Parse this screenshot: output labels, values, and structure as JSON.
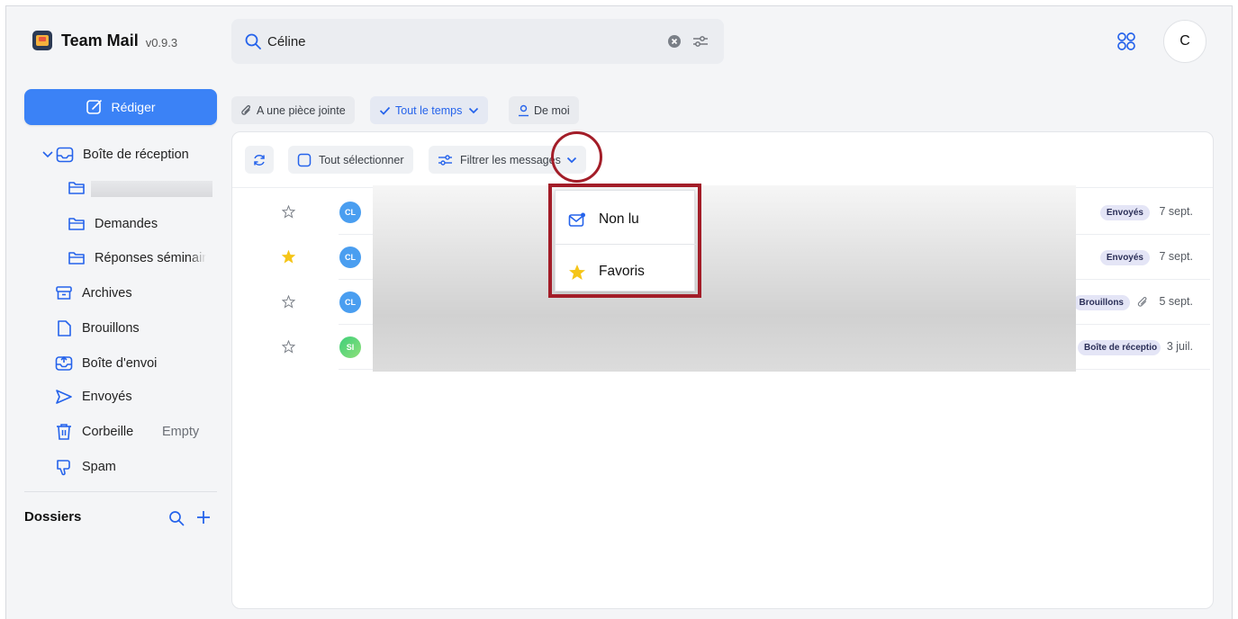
{
  "app": {
    "name": "Team Mail",
    "version": "v0.9.3"
  },
  "search": {
    "value": "Céline"
  },
  "user": {
    "initial": "C"
  },
  "sidebar": {
    "compose_label": "Rédiger",
    "inbox_label": "Boîte de réception",
    "inbox_children": [
      "",
      "Demandes",
      "Réponses séminair"
    ],
    "items": [
      {
        "label": "Archives",
        "icon": "archive-icon"
      },
      {
        "label": "Brouillons",
        "icon": "draft-icon"
      },
      {
        "label": "Boîte d'envoi",
        "icon": "outbox-icon"
      },
      {
        "label": "Envoyés",
        "icon": "send-icon"
      },
      {
        "label": "Corbeille",
        "icon": "trash-icon"
      },
      {
        "label": "Spam",
        "icon": "thumbs-down-icon"
      }
    ],
    "trash_action": "Empty",
    "folders_title": "Dossiers"
  },
  "filters": {
    "attachment": "A une pièce jointe",
    "time": "Tout le temps",
    "from_me": "De moi"
  },
  "toolbar": {
    "select_all": "Tout sélectionner",
    "filter_messages": "Filtrer les messages"
  },
  "messages": [
    {
      "initials": "CL",
      "starred": false,
      "folder": "Envoyés",
      "date": "7 sept.",
      "attachment": false,
      "avatar_color": "#4a9ef0"
    },
    {
      "initials": "CL",
      "starred": true,
      "folder": "Envoyés",
      "date": "7 sept.",
      "attachment": false,
      "avatar_color": "#4a9ef0"
    },
    {
      "initials": "CL",
      "starred": false,
      "folder": "Brouillons",
      "date": "5 sept.",
      "attachment": true,
      "avatar_color": "#4a9ef0"
    },
    {
      "initials": "SI",
      "starred": false,
      "folder": "Boîte de réceptio",
      "date": "3 juil.",
      "attachment": false,
      "avatar_color": "#3fcf7a"
    }
  ],
  "dropdown": {
    "items": [
      {
        "label": "Non lu",
        "icon": "unread-mail-icon"
      },
      {
        "label": "Favoris",
        "icon": "star-icon"
      }
    ]
  },
  "colors": {
    "accent": "#3b82f6",
    "highlight": "#a31d28",
    "star": "#f5c518"
  }
}
